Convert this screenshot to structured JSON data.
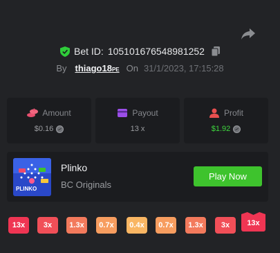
{
  "header": {
    "share_icon": "share-icon",
    "bet_label": "Bet ID:",
    "bet_id": "105101676548981252",
    "by_label": "By",
    "username": "thiago18",
    "username_suffix": "PE",
    "on_label": "On",
    "date": "31/1/2023, 17:15:28"
  },
  "stats": [
    {
      "label": "Amount",
      "value": "$0.16",
      "icon": "coins-icon",
      "color": "#e84f6f"
    },
    {
      "label": "Payout",
      "value": "13 x",
      "icon": "card-icon",
      "color": "#9b4ee8"
    },
    {
      "label": "Profit",
      "value": "$1.92",
      "icon": "profit-user-icon",
      "color": "#e84f4f"
    }
  ],
  "game": {
    "title": "Plinko",
    "provider": "BC Originals",
    "play_label": "Play Now",
    "thumbnail_text": "PLINKO"
  },
  "buckets": [
    {
      "label": "13x",
      "color": "#ef3553"
    },
    {
      "label": "3x",
      "color": "#f14f58"
    },
    {
      "label": "1.3x",
      "color": "#f37a5c"
    },
    {
      "label": "0.7x",
      "color": "#f79d5f"
    },
    {
      "label": "0.4x",
      "color": "#f9b663"
    },
    {
      "label": "0.7x",
      "color": "#f79d5f"
    },
    {
      "label": "1.3x",
      "color": "#f37a5c"
    },
    {
      "label": "3x",
      "color": "#f14f58"
    },
    {
      "label": "13x",
      "color": "#ef3553",
      "active": true
    }
  ],
  "colors": {
    "accent_green": "#3ec32d",
    "profit_green": "#3fd83f",
    "card_bg": "#1b1c1f",
    "page_bg": "#222326"
  }
}
